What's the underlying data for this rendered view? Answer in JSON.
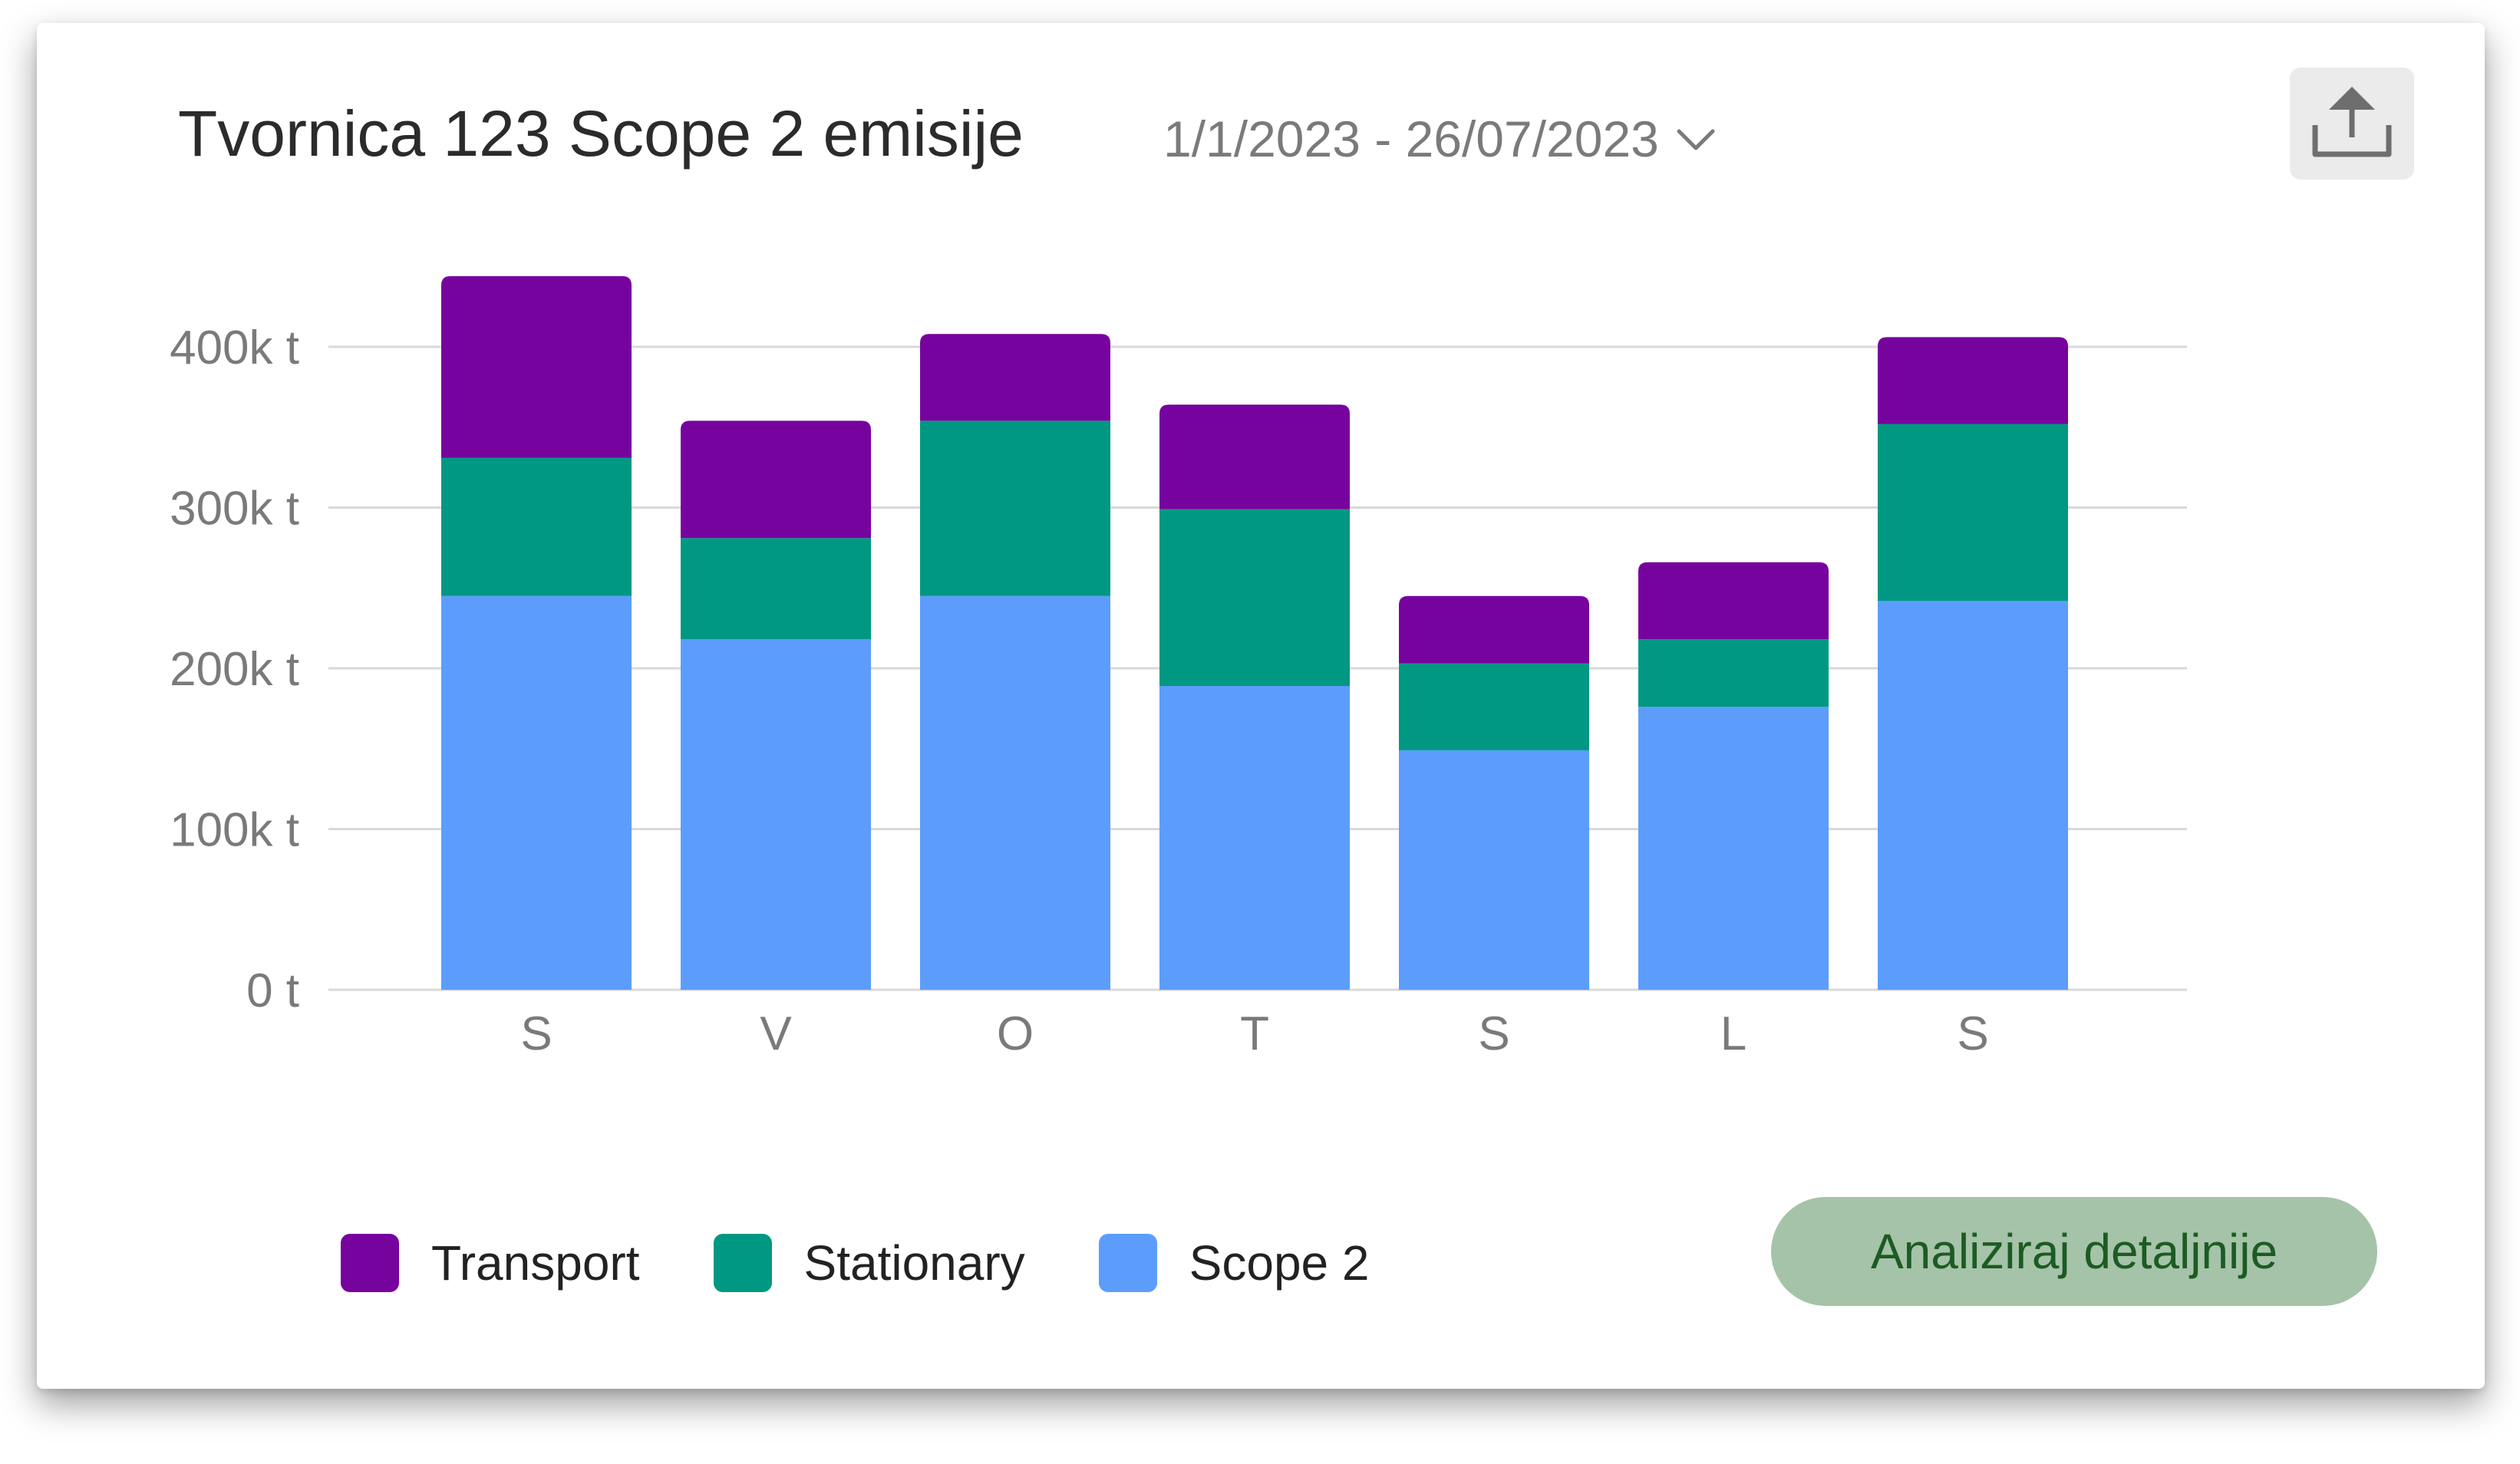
{
  "header": {
    "title": "Tvornica 123 Scope 2 emisije",
    "date_range": "1/1/2023 - 26/07/2023",
    "date_range_icon": "chevron-down-icon",
    "export_icon": "export-upload-icon"
  },
  "actions": {
    "analyze_label": "Analiziraj detaljnije"
  },
  "colors": {
    "transport": "#76039e",
    "stationary": "#009882",
    "scope2": "#5c9dfc",
    "grid": "#d9d9d9",
    "axis_text": "#7a7a7a",
    "button_bg": "#a5c3a8",
    "button_text": "#1c5b23"
  },
  "chart_data": {
    "type": "bar",
    "stacked": true,
    "categories": [
      "S",
      "V",
      "O",
      "T",
      "S",
      "L",
      "S"
    ],
    "series": [
      {
        "name": "Scope 2",
        "values": [
          245,
          218,
          245,
          189,
          149,
          176,
          242
        ]
      },
      {
        "name": "Stationary",
        "values": [
          86,
          63,
          109,
          110,
          54,
          42,
          110
        ]
      },
      {
        "name": "Transport",
        "values": [
          113,
          73,
          54,
          65,
          42,
          48,
          54
        ]
      }
    ],
    "y_ticks": [
      "0 t",
      "100k t",
      "200k t",
      "300k t",
      "400k t"
    ],
    "y_unit": "k t",
    "ylim": [
      0,
      400
    ],
    "grid": true,
    "legend_position": "bottom-left"
  },
  "legend": [
    {
      "label": "Transport",
      "color": "#76039e"
    },
    {
      "label": "Stationary",
      "color": "#009882"
    },
    {
      "label": "Scope 2",
      "color": "#5c9dfc"
    }
  ]
}
